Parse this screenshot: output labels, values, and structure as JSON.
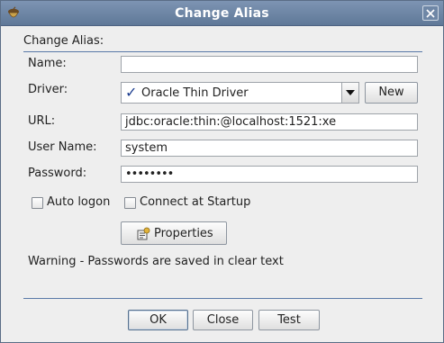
{
  "window": {
    "title": "Change Alias"
  },
  "form": {
    "heading": "Change Alias:",
    "name": {
      "label": "Name:",
      "value": ""
    },
    "driver": {
      "label": "Driver:",
      "value": "Oracle Thin Driver",
      "new_label": "New"
    },
    "url": {
      "label": "URL:",
      "value": "jdbc:oracle:thin:@localhost:1521:xe"
    },
    "user": {
      "label": "User Name:",
      "value": "system"
    },
    "password": {
      "label": "Password:",
      "value": "••••••••"
    },
    "auto_logon": {
      "label": "Auto logon",
      "checked": false
    },
    "connect_startup": {
      "label": "Connect at Startup",
      "checked": false
    },
    "properties_label": "Properties",
    "warning": "Warning - Passwords are saved in clear text"
  },
  "footer": {
    "ok": "OK",
    "close": "Close",
    "test": "Test"
  },
  "colors": {
    "titlebar": "#6a83a4",
    "separator": "#5a7aa8",
    "check": "#1c3d8f"
  }
}
